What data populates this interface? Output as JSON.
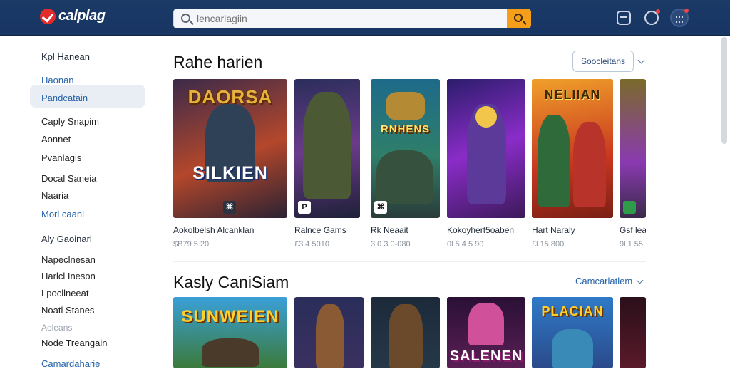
{
  "header": {
    "logo_text": "calplag",
    "search_placeholder": "lencarlagiin",
    "brand_color": "#1b3a66",
    "accent_color": "#f59e1a",
    "icons": [
      "cart-icon",
      "bell-icon",
      "avatar-icon"
    ]
  },
  "sidebar": {
    "group1_title": "Kpl Hanean",
    "group1_items": [
      {
        "label": "Haonan",
        "style": "blue"
      },
      {
        "label": "Pandcatain",
        "style": "active"
      },
      {
        "label": "Caply Snapim"
      },
      {
        "label": "Aonnet"
      },
      {
        "label": "Pvanlagis"
      },
      {
        "label": "Docal Saneia"
      },
      {
        "label": "Naaria"
      },
      {
        "label": "Morl caanl",
        "style": "blue"
      }
    ],
    "group2_title": "Aly Gaoinarl",
    "group2_items": [
      {
        "label": "Napeclnesan"
      },
      {
        "label": "Harlcl Ineson"
      },
      {
        "label": "Lpocllneeat"
      },
      {
        "label": "Noatl Stanes"
      },
      {
        "label": "Aoleans",
        "style": "faded"
      },
      {
        "label": "Node Treangain"
      },
      {
        "label": "Camardaharie",
        "style": "blue"
      }
    ]
  },
  "sections": [
    {
      "title": "Rahe harien",
      "control_label": "Soocleitans",
      "cards": [
        {
          "art_title": "DAORSA",
          "art_subtitle": "SILKIEN",
          "title": "Aokolbelsh Alcanklan",
          "price": "$B79 5 20",
          "badge": "⌘"
        },
        {
          "art_title": "",
          "art_subtitle": "",
          "title": "Ralnce Gams",
          "price": "£3 4 5010",
          "badge": "P"
        },
        {
          "art_title": "RNHENS",
          "art_subtitle": "",
          "title": "Rk Neaait",
          "price": "3 0 3 0-080",
          "badge": "⌘"
        },
        {
          "art_title": "",
          "art_subtitle": "",
          "title": "Kokoyhert5oaben",
          "price": "0l 5 4 5 90",
          "badge": ""
        },
        {
          "art_title": "NELIIAN",
          "art_subtitle": "",
          "title": "Hart Naraly",
          "price": "£l 15 800",
          "badge": ""
        },
        {
          "art_title": "",
          "art_subtitle": "",
          "title": "Gsf lea",
          "price": "9l 1 55",
          "badge": ""
        }
      ]
    },
    {
      "title": "Kasly CaniSiam",
      "control_label": "Camcarlatlem",
      "cards": [
        {
          "art_title": "SUNWEIEN",
          "art_subtitle": "",
          "title": "",
          "price": "",
          "badge": ""
        },
        {
          "art_title": "",
          "art_subtitle": "",
          "title": "",
          "price": "",
          "badge": ""
        },
        {
          "art_title": "",
          "art_subtitle": "",
          "title": "",
          "price": "",
          "badge": ""
        },
        {
          "art_title": "SALENEN",
          "art_subtitle": "",
          "title": "",
          "price": "",
          "badge": ""
        },
        {
          "art_title": "PLACIAN",
          "art_subtitle": "",
          "title": "",
          "price": "",
          "badge": ""
        },
        {
          "art_title": "",
          "art_subtitle": "",
          "title": "",
          "price": "",
          "badge": ""
        }
      ]
    }
  ]
}
